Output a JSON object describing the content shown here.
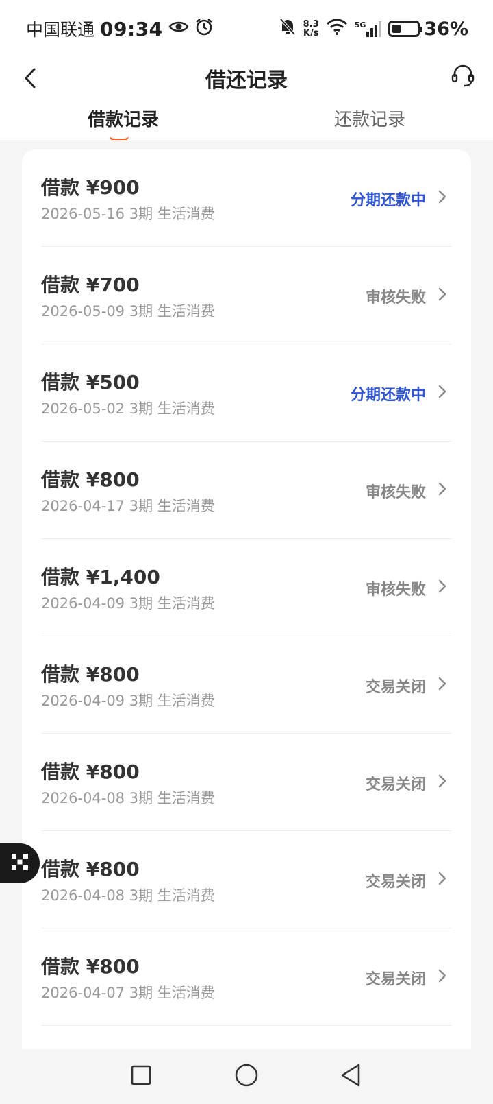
{
  "status_bar": {
    "carrier": "中国联通",
    "time": "09:34",
    "net_speed_value": "8.3",
    "net_speed_unit": "K/s",
    "network": "5G",
    "battery_level": 0.36,
    "battery": "36%",
    "icons": [
      "eye-icon",
      "alarm-icon",
      "bell-muted-icon",
      "wifi-icon",
      "signal-icon",
      "battery-icon"
    ]
  },
  "header": {
    "title": "借还记录",
    "back_icon": "chevron-left-icon",
    "support_icon": "headset-icon"
  },
  "tabs": [
    {
      "label": "借款记录",
      "active": true
    },
    {
      "label": "还款记录",
      "active": false
    }
  ],
  "records": [
    {
      "amount": "借款 ¥900",
      "meta": "2026-05-16 3期  生活消费",
      "status": "分期还款中",
      "active": true
    },
    {
      "amount": "借款 ¥700",
      "meta": "2026-05-09 3期  生活消费",
      "status": "审核失败",
      "active": false
    },
    {
      "amount": "借款 ¥500",
      "meta": "2026-05-02 3期  生活消费",
      "status": "分期还款中",
      "active": true
    },
    {
      "amount": "借款 ¥800",
      "meta": "2026-04-17 3期  生活消费",
      "status": "审核失败",
      "active": false
    },
    {
      "amount": "借款 ¥1,400",
      "meta": "2026-04-09 3期  生活消费",
      "status": "审核失败",
      "active": false
    },
    {
      "amount": "借款 ¥800",
      "meta": "2026-04-09 3期  生活消费",
      "status": "交易关闭",
      "active": false
    },
    {
      "amount": "借款 ¥800",
      "meta": "2026-04-08 3期  生活消费",
      "status": "交易关闭",
      "active": false
    },
    {
      "amount": "借款 ¥800",
      "meta": "2026-04-08 3期  生活消费",
      "status": "交易关闭",
      "active": false
    },
    {
      "amount": "借款 ¥800",
      "meta": "2026-04-07 3期  生活消费",
      "status": "交易关闭",
      "active": false
    }
  ],
  "colors": {
    "accent_orange": "#ff5a1f",
    "status_active_blue": "#2f55d4",
    "status_inactive_gray": "#888888"
  },
  "system_nav": {
    "icons": [
      "recent-apps-icon",
      "home-icon",
      "back-triangle-icon"
    ]
  }
}
